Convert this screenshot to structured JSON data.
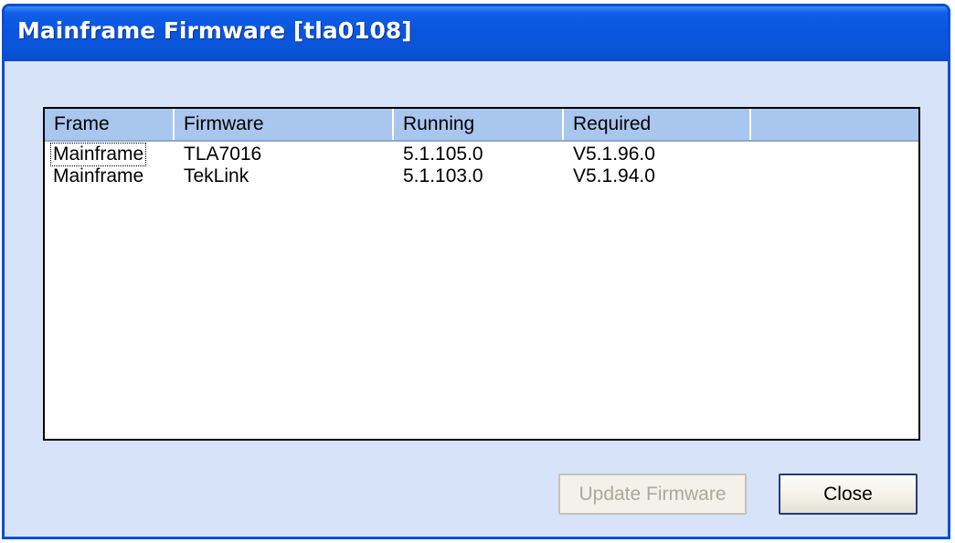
{
  "window": {
    "title": "Mainframe Firmware [tla0108]"
  },
  "table": {
    "columns": [
      "Frame",
      "Firmware",
      "Running",
      "Required",
      ""
    ],
    "rows": [
      {
        "frame": "Mainframe",
        "firmware": "TLA7016",
        "running": "5.1.105.0",
        "required": "V5.1.96.0"
      },
      {
        "frame": "Mainframe",
        "firmware": "TekLink",
        "running": "5.1.103.0",
        "required": "V5.1.94.0"
      }
    ]
  },
  "buttons": {
    "update_label": "Update Firmware",
    "update_enabled": false,
    "close_label": "Close"
  },
  "colors": {
    "titlebar": "#0a55de",
    "dialog_bg": "#d6e3f8",
    "header_bg": "#a9c6ee"
  }
}
